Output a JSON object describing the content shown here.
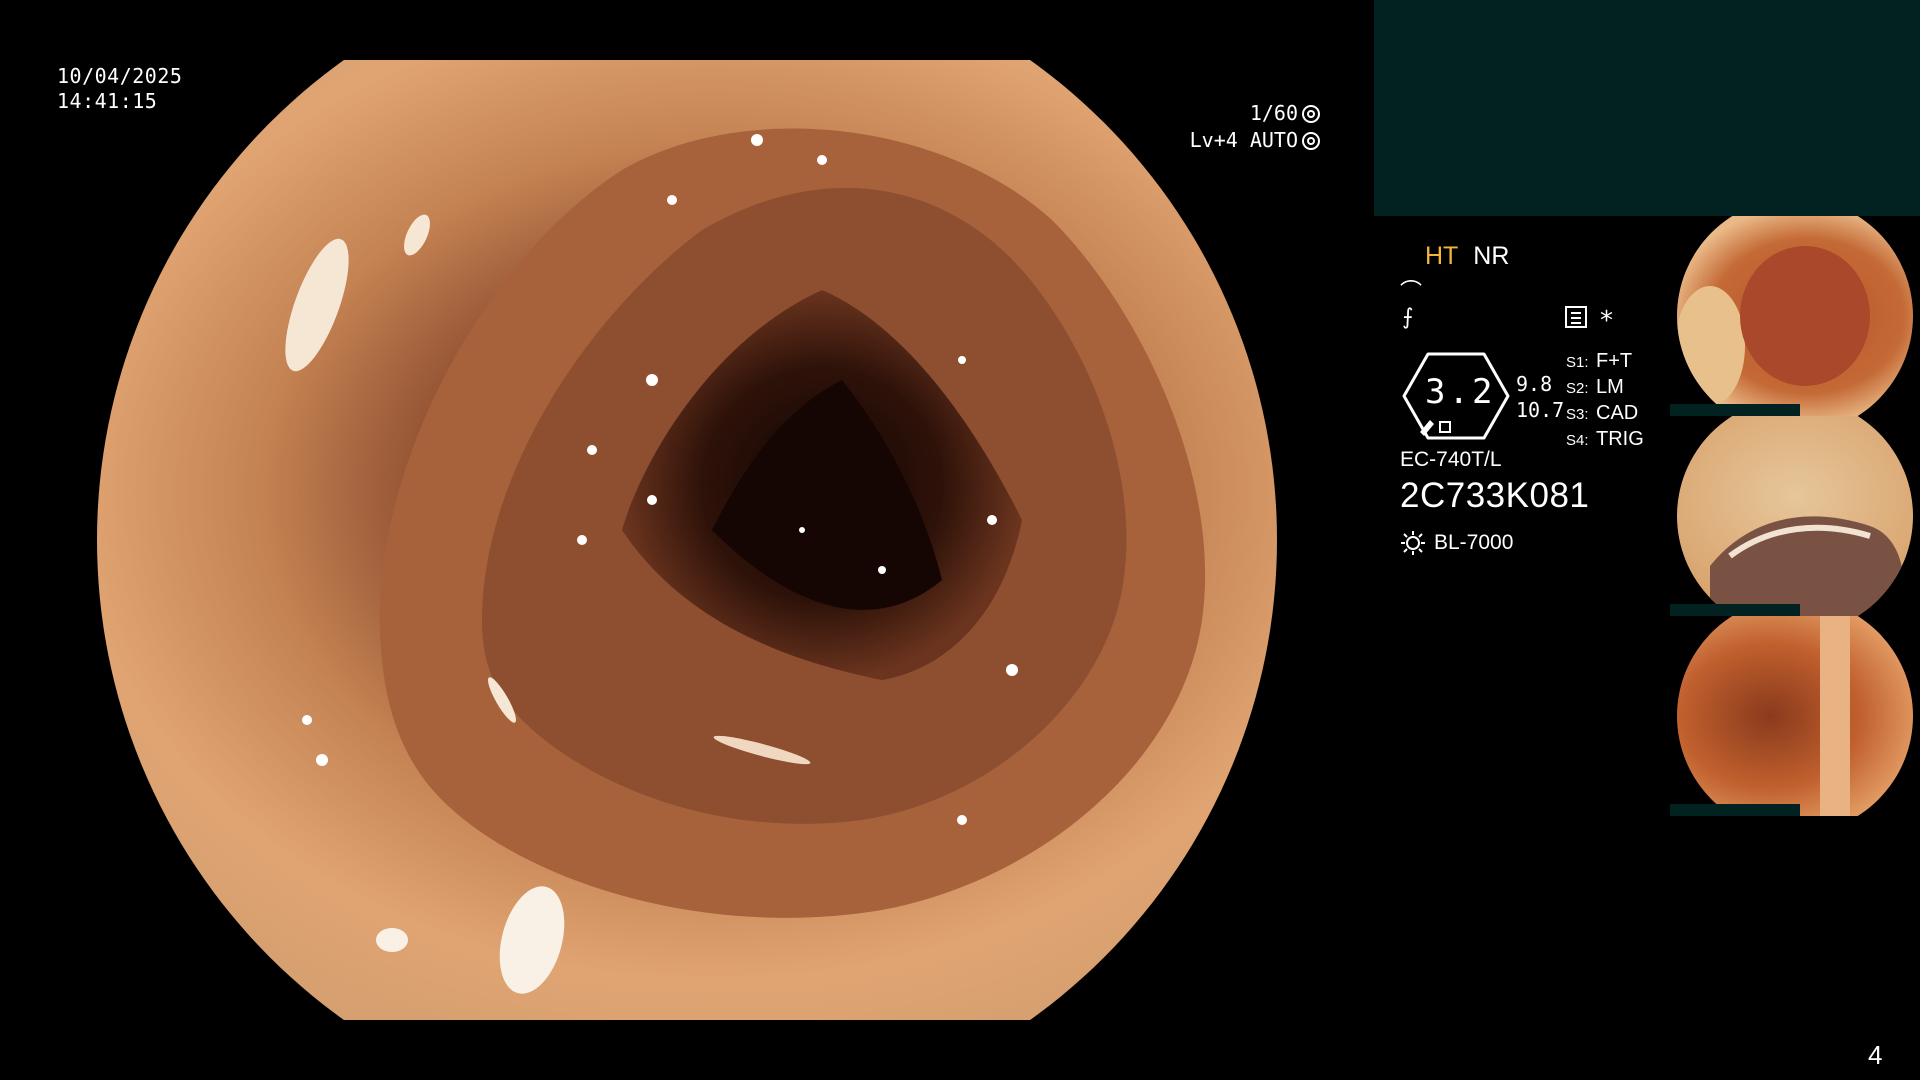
{
  "overlay": {
    "date": "10/04/2025",
    "time": "14:41:15",
    "shutter": "1/60",
    "level": "Lv+4 AUTO"
  },
  "panel": {
    "enhance_label": "HT",
    "noise_label": "NR",
    "gauge_value": "3.2",
    "value_top": "9.8",
    "value_bottom": "10.7",
    "switches": [
      {
        "key": "S1:",
        "value": "F+T"
      },
      {
        "key": "S2:",
        "value": "LM"
      },
      {
        "key": "S3:",
        "value": "CAD"
      },
      {
        "key": "S4:",
        "value": "TRIG"
      }
    ],
    "scope_model": "EC-740T/L",
    "serial": "2C733K081",
    "light_source": "BL-7000",
    "star": "*"
  },
  "thumbnails": [
    {
      "name": "capture-1"
    },
    {
      "name": "capture-2"
    },
    {
      "name": "capture-3"
    }
  ],
  "page_number": "4",
  "colors": {
    "highlight": "#f2b43a",
    "panel_teal": "#022222",
    "mucosa": "#b8703d"
  },
  "icons": [
    "shutter-icon",
    "auto-iris-icon",
    "enhance-mode-icon",
    "color-mode-icon",
    "menu-icon",
    "light-source-icon"
  ]
}
